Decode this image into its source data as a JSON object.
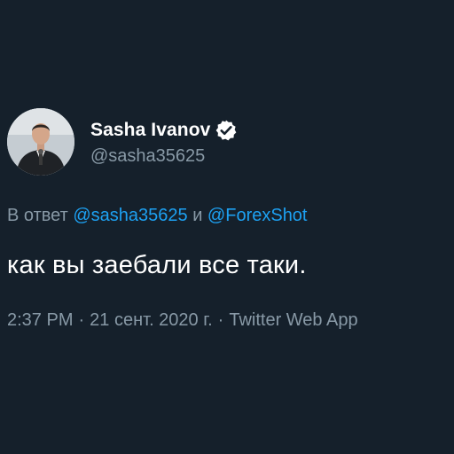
{
  "author": {
    "display_name": "Sasha Ivanov",
    "handle": "@sasha35625",
    "verified_icon": "verified-badge-icon"
  },
  "reply": {
    "prefix": "В ответ",
    "mention_1": "@sasha35625",
    "conjunction": "и",
    "mention_2": "@ForexShot"
  },
  "tweet": {
    "text": "как вы заебали все таки."
  },
  "meta": {
    "time": "2:37 PM",
    "separator": "·",
    "date": "21 сент. 2020 г.",
    "source": "Twitter Web App"
  },
  "colors": {
    "background": "#15202b",
    "primary_text": "#ffffff",
    "secondary_text": "#8899a6",
    "link": "#1da1f2"
  }
}
